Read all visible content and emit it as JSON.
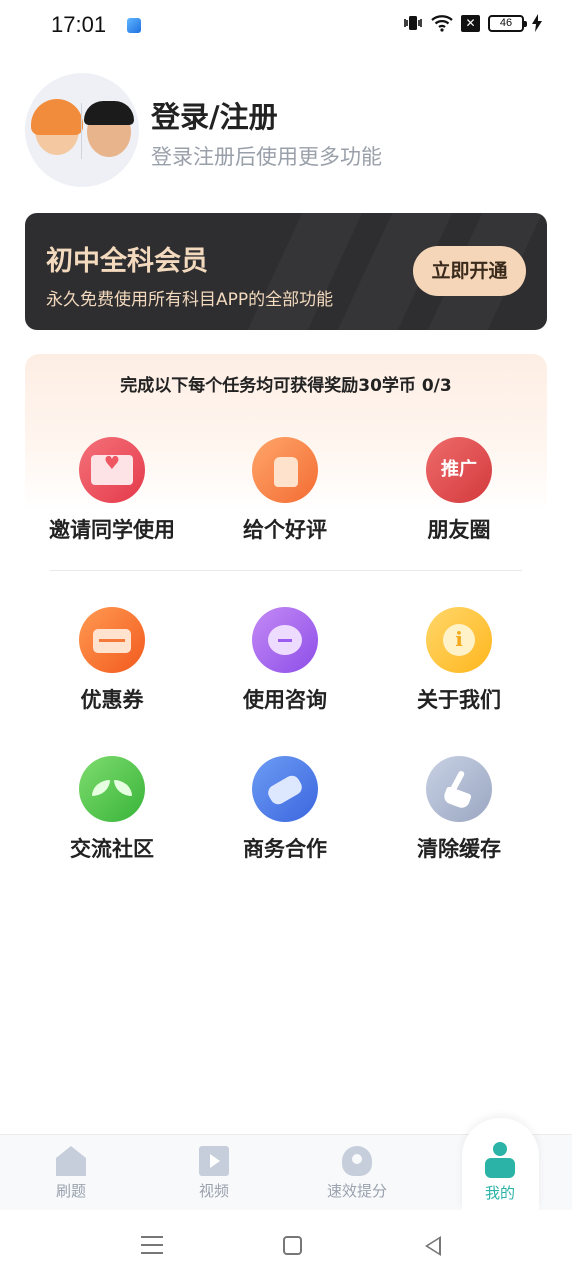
{
  "status_bar": {
    "time": "17:01",
    "battery": "46"
  },
  "profile": {
    "title": "登录/注册",
    "subtitle": "登录注册后使用更多功能"
  },
  "vip_banner": {
    "title": "初中全科会员",
    "subtitle": "永久免费使用所有科目APP的全部功能",
    "button": "立即开通"
  },
  "tasks": {
    "header": "完成以下每个任务均可获得奖励30学币 0/3",
    "items": [
      {
        "label": "邀请同学使用",
        "icon": "invite-icon"
      },
      {
        "label": "给个好评",
        "icon": "thumbs-up-icon"
      },
      {
        "label": "朋友圈",
        "icon": "promote-icon",
        "icon_text": "推广"
      }
    ]
  },
  "features": {
    "items": [
      {
        "label": "优惠券",
        "icon": "coupon-icon"
      },
      {
        "label": "使用咨询",
        "icon": "chat-icon"
      },
      {
        "label": "关于我们",
        "icon": "info-icon"
      },
      {
        "label": "交流社区",
        "icon": "sprout-icon"
      },
      {
        "label": "商务合作",
        "icon": "handshake-icon"
      },
      {
        "label": "清除缓存",
        "icon": "broom-icon"
      }
    ]
  },
  "tabbar": {
    "items": [
      {
        "label": "刷题",
        "icon": "home-icon"
      },
      {
        "label": "视频",
        "icon": "video-icon"
      },
      {
        "label": "速效提分",
        "icon": "rocket-icon"
      },
      {
        "label": "我的",
        "icon": "profile-icon",
        "active": true
      }
    ]
  },
  "colors": {
    "accent": "#2bb3a8",
    "vip_bg": "#2e2e30",
    "vip_gold": "#f3d9bd",
    "inactive": "#9aa2ae"
  }
}
